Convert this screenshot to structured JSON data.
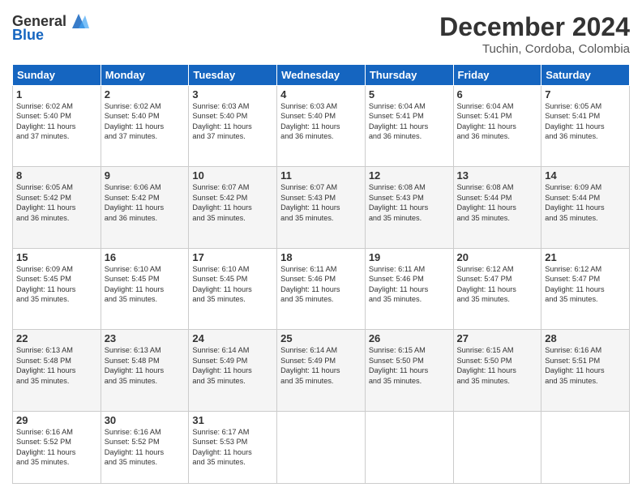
{
  "header": {
    "logo_general": "General",
    "logo_blue": "Blue",
    "month_title": "December 2024",
    "location": "Tuchin, Cordoba, Colombia"
  },
  "days_of_week": [
    "Sunday",
    "Monday",
    "Tuesday",
    "Wednesday",
    "Thursday",
    "Friday",
    "Saturday"
  ],
  "weeks": [
    [
      {
        "day": 1,
        "sunrise": "6:02 AM",
        "sunset": "5:40 PM",
        "daylight": "11 hours and 37 minutes."
      },
      {
        "day": 2,
        "sunrise": "6:02 AM",
        "sunset": "5:40 PM",
        "daylight": "11 hours and 37 minutes."
      },
      {
        "day": 3,
        "sunrise": "6:03 AM",
        "sunset": "5:40 PM",
        "daylight": "11 hours and 37 minutes."
      },
      {
        "day": 4,
        "sunrise": "6:03 AM",
        "sunset": "5:40 PM",
        "daylight": "11 hours and 36 minutes."
      },
      {
        "day": 5,
        "sunrise": "6:04 AM",
        "sunset": "5:41 PM",
        "daylight": "11 hours and 36 minutes."
      },
      {
        "day": 6,
        "sunrise": "6:04 AM",
        "sunset": "5:41 PM",
        "daylight": "11 hours and 36 minutes."
      },
      {
        "day": 7,
        "sunrise": "6:05 AM",
        "sunset": "5:41 PM",
        "daylight": "11 hours and 36 minutes."
      }
    ],
    [
      {
        "day": 8,
        "sunrise": "6:05 AM",
        "sunset": "5:42 PM",
        "daylight": "11 hours and 36 minutes."
      },
      {
        "day": 9,
        "sunrise": "6:06 AM",
        "sunset": "5:42 PM",
        "daylight": "11 hours and 36 minutes."
      },
      {
        "day": 10,
        "sunrise": "6:07 AM",
        "sunset": "5:42 PM",
        "daylight": "11 hours and 35 minutes."
      },
      {
        "day": 11,
        "sunrise": "6:07 AM",
        "sunset": "5:43 PM",
        "daylight": "11 hours and 35 minutes."
      },
      {
        "day": 12,
        "sunrise": "6:08 AM",
        "sunset": "5:43 PM",
        "daylight": "11 hours and 35 minutes."
      },
      {
        "day": 13,
        "sunrise": "6:08 AM",
        "sunset": "5:44 PM",
        "daylight": "11 hours and 35 minutes."
      },
      {
        "day": 14,
        "sunrise": "6:09 AM",
        "sunset": "5:44 PM",
        "daylight": "11 hours and 35 minutes."
      }
    ],
    [
      {
        "day": 15,
        "sunrise": "6:09 AM",
        "sunset": "5:45 PM",
        "daylight": "11 hours and 35 minutes."
      },
      {
        "day": 16,
        "sunrise": "6:10 AM",
        "sunset": "5:45 PM",
        "daylight": "11 hours and 35 minutes."
      },
      {
        "day": 17,
        "sunrise": "6:10 AM",
        "sunset": "5:45 PM",
        "daylight": "11 hours and 35 minutes."
      },
      {
        "day": 18,
        "sunrise": "6:11 AM",
        "sunset": "5:46 PM",
        "daylight": "11 hours and 35 minutes."
      },
      {
        "day": 19,
        "sunrise": "6:11 AM",
        "sunset": "5:46 PM",
        "daylight": "11 hours and 35 minutes."
      },
      {
        "day": 20,
        "sunrise": "6:12 AM",
        "sunset": "5:47 PM",
        "daylight": "11 hours and 35 minutes."
      },
      {
        "day": 21,
        "sunrise": "6:12 AM",
        "sunset": "5:47 PM",
        "daylight": "11 hours and 35 minutes."
      }
    ],
    [
      {
        "day": 22,
        "sunrise": "6:13 AM",
        "sunset": "5:48 PM",
        "daylight": "11 hours and 35 minutes."
      },
      {
        "day": 23,
        "sunrise": "6:13 AM",
        "sunset": "5:48 PM",
        "daylight": "11 hours and 35 minutes."
      },
      {
        "day": 24,
        "sunrise": "6:14 AM",
        "sunset": "5:49 PM",
        "daylight": "11 hours and 35 minutes."
      },
      {
        "day": 25,
        "sunrise": "6:14 AM",
        "sunset": "5:49 PM",
        "daylight": "11 hours and 35 minutes."
      },
      {
        "day": 26,
        "sunrise": "6:15 AM",
        "sunset": "5:50 PM",
        "daylight": "11 hours and 35 minutes."
      },
      {
        "day": 27,
        "sunrise": "6:15 AM",
        "sunset": "5:50 PM",
        "daylight": "11 hours and 35 minutes."
      },
      {
        "day": 28,
        "sunrise": "6:16 AM",
        "sunset": "5:51 PM",
        "daylight": "11 hours and 35 minutes."
      }
    ],
    [
      {
        "day": 29,
        "sunrise": "6:16 AM",
        "sunset": "5:52 PM",
        "daylight": "11 hours and 35 minutes."
      },
      {
        "day": 30,
        "sunrise": "6:16 AM",
        "sunset": "5:52 PM",
        "daylight": "11 hours and 35 minutes."
      },
      {
        "day": 31,
        "sunrise": "6:17 AM",
        "sunset": "5:53 PM",
        "daylight": "11 hours and 35 minutes."
      },
      null,
      null,
      null,
      null
    ]
  ]
}
